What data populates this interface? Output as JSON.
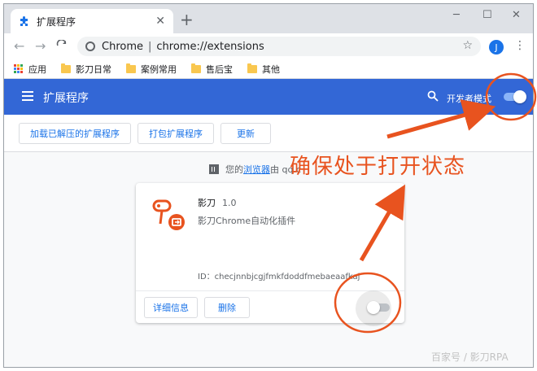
{
  "tab": {
    "title": "扩展程序",
    "close": "✕"
  },
  "new_tab": "+",
  "window_controls": {
    "minimize": "─",
    "maximize": "☐",
    "close": "✕"
  },
  "toolbar": {
    "back": "←",
    "forward": "→",
    "reload": "C",
    "host": "Chrome",
    "separator": "|",
    "url": "chrome://extensions",
    "star": "☆",
    "avatar_letter": "J",
    "menu": "⋮"
  },
  "bookmarks": [
    {
      "label": "应用",
      "icon": "apps-grid-icon"
    },
    {
      "label": "影刀日常",
      "icon": "folder-icon"
    },
    {
      "label": "案例常用",
      "icon": "folder-icon"
    },
    {
      "label": "售后宝",
      "icon": "folder-icon"
    },
    {
      "label": "其他",
      "icon": "folder-icon"
    }
  ],
  "header": {
    "title": "扩展程序",
    "dev_mode_label": "开发者模式",
    "dev_mode_on": true
  },
  "actions": {
    "load_unpacked": "加载已解压的扩展程序",
    "pack": "打包扩展程序",
    "update": "更新"
  },
  "managed": {
    "prefix": "您的",
    "link": "浏览器",
    "suffix": "由 qq.c"
  },
  "extension": {
    "name": "影刀",
    "version": "1.0",
    "description": "影刀Chrome自动化插件",
    "id_label": "ID：",
    "id": "checjnnbjcgjfmkfdoddfmebaeaafkaj",
    "details": "详细信息",
    "remove": "删除",
    "enabled": false
  },
  "annotation": {
    "text": "确保处于打开状态",
    "color": "#e8531f"
  },
  "watermark": "百家号 / 影刀RPA",
  "colors": {
    "header_blue": "#3367d6",
    "link_blue": "#1a73e8",
    "brand_orange": "#e8531f"
  }
}
